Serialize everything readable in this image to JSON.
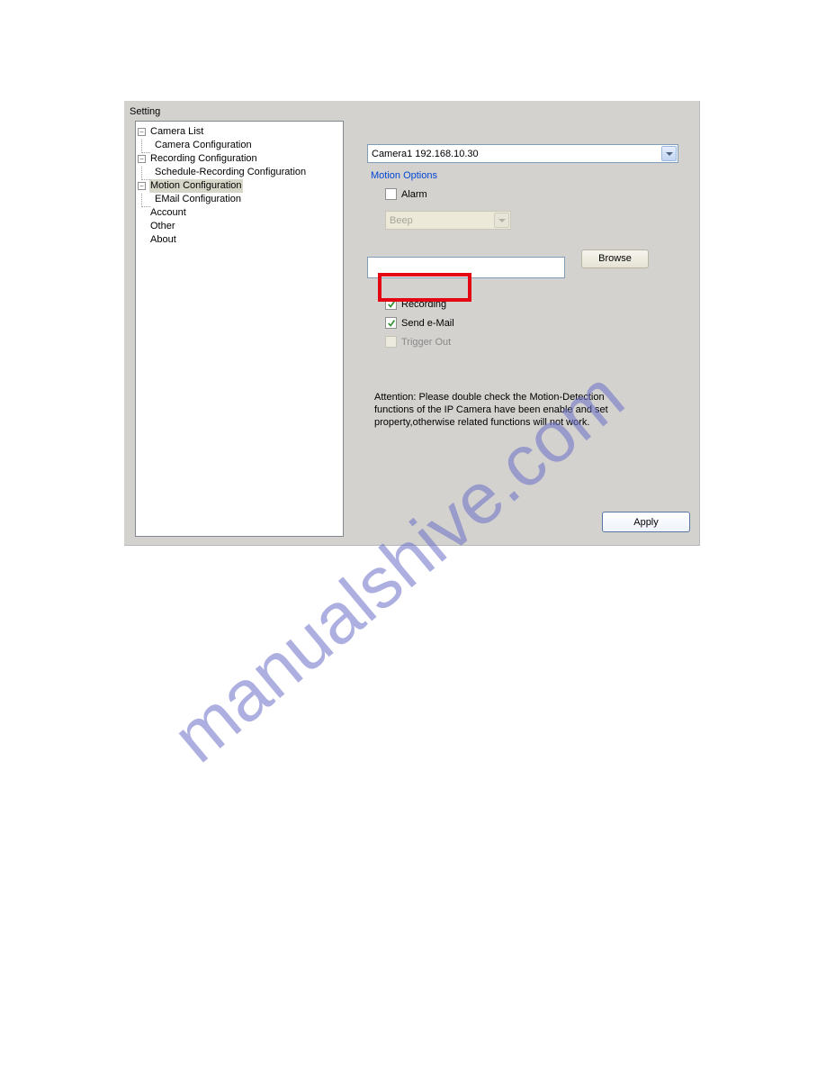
{
  "panel": {
    "title": "Setting"
  },
  "tree": {
    "camera_list": "Camera List",
    "camera_config": "Camera Configuration",
    "recording_config": "Recording Configuration",
    "schedule_rec": "Schedule-Recording Configuration",
    "motion_config": "Motion Configuration",
    "email_config": "EMail Configuration",
    "account": "Account",
    "other": "Other",
    "about": "About"
  },
  "camera_select": {
    "value": "Camera1 192.168.10.30"
  },
  "motion_options": {
    "label": "Motion Options",
    "alarm": "Alarm",
    "beep": "Beep",
    "browse": "Browse",
    "recording": "Recording",
    "send_email": "Send e-Mail",
    "trigger_out": "Trigger Out"
  },
  "attention": "Attention: Please double check the Motion-Detection functions of the IP Camera have been enable and set property,otherwise related functions will not work.",
  "buttons": {
    "apply": "Apply"
  },
  "watermark": "manualshive.com"
}
